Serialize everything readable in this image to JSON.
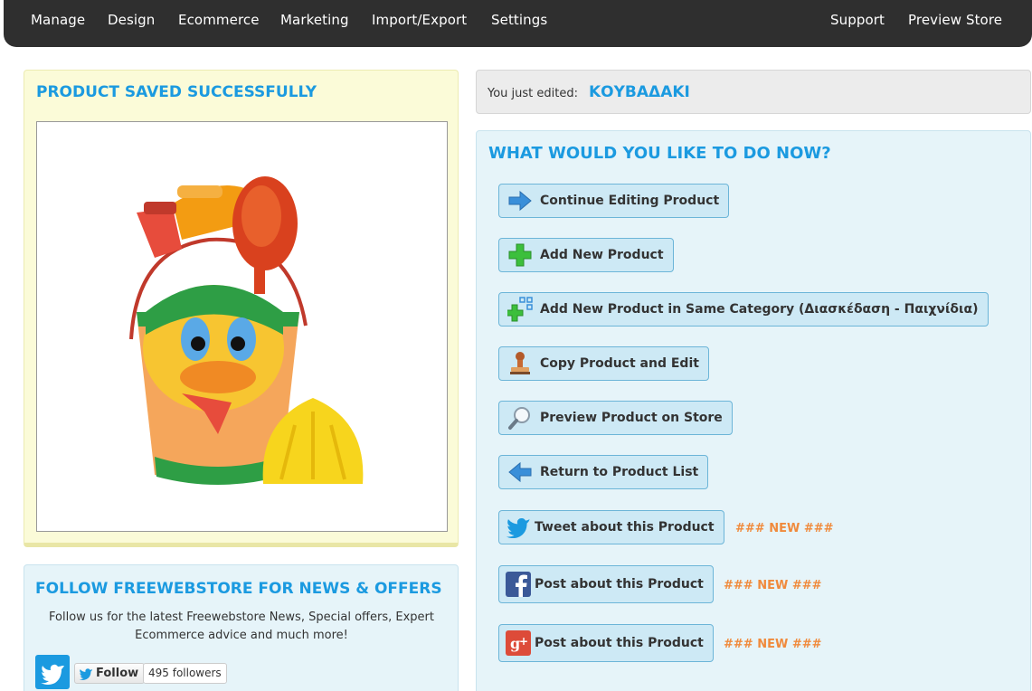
{
  "nav": {
    "manage": "Manage",
    "design": "Design",
    "ecommerce": "Ecommerce",
    "marketing": "Marketing",
    "import_export": "Import/Export",
    "settings": "Settings",
    "support": "Support",
    "preview_store": "Preview Store"
  },
  "saved": {
    "title": "PRODUCT SAVED SUCCESSFULLY"
  },
  "follow": {
    "title": "FOLLOW FREEWEBSTORE FOR NEWS & OFFERS",
    "text_line1": "Follow us for the latest Freewebstore News, Special offers, Expert",
    "text_line2": "Ecommerce advice and much more!",
    "follow_label": "Follow",
    "followers": "495 followers"
  },
  "edited": {
    "label": "You just edited:",
    "product_name": "ΚΟΥΒΑΔΑΚΙ"
  },
  "actions": {
    "title": "WHAT WOULD YOU LIKE TO DO NOW?",
    "continue_editing": "Continue Editing Product",
    "add_new": "Add New Product",
    "add_same_category": "Add New Product in Same Category (Διασκέδαση - Παιχνίδια)",
    "copy_edit": "Copy Product and Edit",
    "preview": "Preview Product on Store",
    "return_list": "Return to Product List",
    "tweet": "Tweet about this Product",
    "facebook": "Post about this Product",
    "google": "Post about this Product",
    "new_tag_1": "### NEW ###",
    "new_tag_2": "### NEW ###",
    "new_tag_3": "### NEW ###"
  },
  "icons": {
    "continue": "arrow-right-icon",
    "add": "plus-icon",
    "add_category": "plus-hierarchy-icon",
    "copy": "stamp-icon",
    "preview": "magnifier-icon",
    "return": "arrow-left-icon",
    "twitter": "twitter-icon",
    "facebook": "facebook-icon",
    "google": "google-plus-icon"
  },
  "colors": {
    "accent": "#1b9ae0",
    "new_tag": "#f08a3c",
    "nav_bg": "#2f2f2f"
  }
}
